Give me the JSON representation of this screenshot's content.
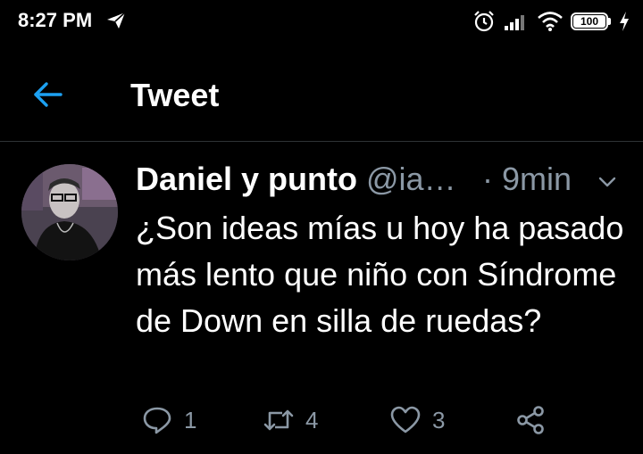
{
  "status_bar": {
    "time": "8:27 PM",
    "battery": "100",
    "icons": [
      "telegram-send-icon",
      "alarm-icon",
      "signal-icon",
      "wifi-icon",
      "battery-icon",
      "charging-icon"
    ]
  },
  "header": {
    "title": "Tweet",
    "back_icon": "arrow-left-icon"
  },
  "tweet": {
    "author_name": "Daniel y punto",
    "handle": "@ia…",
    "time": "· 9min",
    "text": "¿Son ideas mías u hoy ha pasado más lento que niño con Síndrome de Down en silla de ruedas?",
    "actions": {
      "reply_count": "1",
      "retweet_count": "4",
      "like_count": "3"
    }
  },
  "colors": {
    "background": "#000000",
    "accent": "#1da1f2",
    "secondary_text": "#8b98a5",
    "divider": "#2f3336"
  }
}
